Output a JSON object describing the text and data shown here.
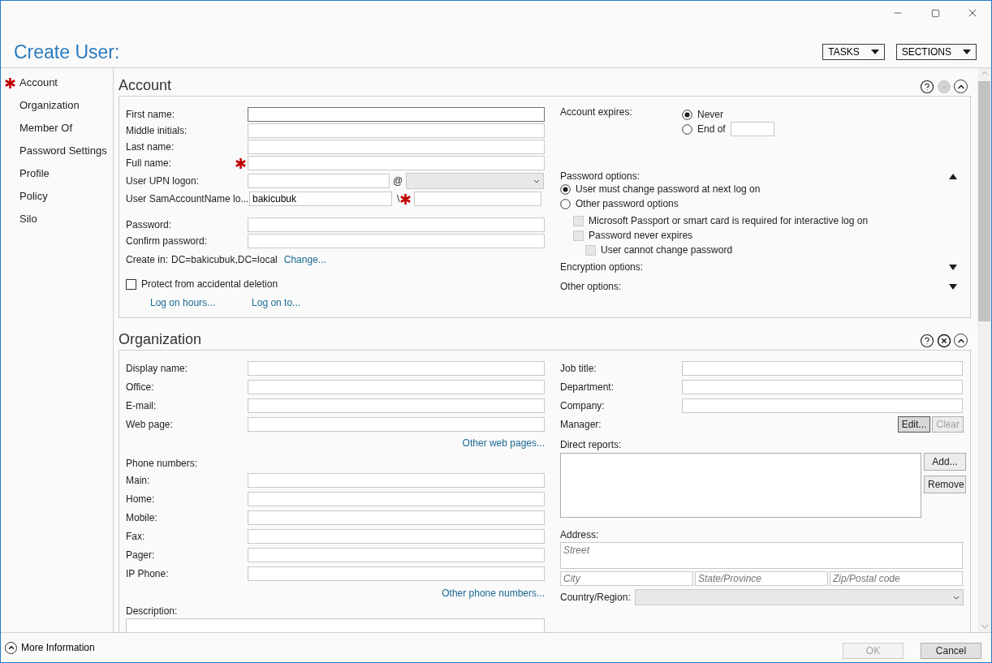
{
  "window": {
    "title": "Create User:"
  },
  "header_buttons": [
    {
      "label": "TASKS"
    },
    {
      "label": "SECTIONS"
    }
  ],
  "nav": [
    {
      "label": "Account",
      "required": true
    },
    {
      "label": "Organization",
      "required": false
    },
    {
      "label": "Member Of",
      "required": false
    },
    {
      "label": "Password Settings",
      "required": false
    },
    {
      "label": "Profile",
      "required": false
    },
    {
      "label": "Policy",
      "required": false
    },
    {
      "label": "Silo",
      "required": false
    }
  ],
  "account": {
    "title": "Account",
    "close_disabled": true,
    "identity_fields": [
      {
        "kind": "text",
        "label": "First name:",
        "required": false,
        "focused": true
      },
      {
        "kind": "text",
        "label": "Middle initials:",
        "required": false,
        "focused": false
      },
      {
        "kind": "text",
        "label": "Last name:",
        "required": false,
        "focused": false
      },
      {
        "kind": "text",
        "label": "Full name:",
        "required": true,
        "focused": false
      },
      {
        "kind": "upn",
        "label": "User UPN logon:",
        "separator": "@",
        "required": false,
        "focused": false
      },
      {
        "kind": "sam",
        "label": "User SamAccountName lo...",
        "value": "bakicubuk",
        "separator": "\\",
        "required": true,
        "focused": false
      }
    ],
    "password_fields": [
      {
        "label": "Password:"
      },
      {
        "label": "Confirm password:"
      }
    ],
    "create_in": {
      "label": "Create in:",
      "value": "DC=bakicubuk,DC=local",
      "link": "Change..."
    },
    "protect": {
      "label": "Protect from accidental deletion",
      "checked": false
    },
    "links": [
      "Log on hours...",
      "Log on to..."
    ],
    "expires": {
      "label": "Account expires:",
      "options": [
        {
          "label": "Never",
          "selected": true
        },
        {
          "label": "End of",
          "selected": false
        }
      ]
    },
    "password_options": {
      "label": "Password options:",
      "expanded": true,
      "options": [
        {
          "label": "User must change password at next log on",
          "selected": true
        },
        {
          "label": "Other password options",
          "selected": false
        }
      ],
      "checkboxes": [
        {
          "label": "Microsoft Passport or smart card is required for interactive log on",
          "checked": false,
          "disabled": true
        },
        {
          "label": "Password never expires",
          "checked": false,
          "disabled": true,
          "children": [
            {
              "label": "User cannot change password",
              "checked": false,
              "disabled": true
            }
          ]
        }
      ]
    },
    "collapsibles": [
      {
        "label": "Encryption options:",
        "expanded": false
      },
      {
        "label": "Other options:",
        "expanded": false
      }
    ]
  },
  "organization": {
    "title": "Organization",
    "close_disabled": false,
    "fields": [
      {
        "label": "Display name:"
      },
      {
        "label": "Office:"
      },
      {
        "label": "E-mail:"
      },
      {
        "label": "Web page:"
      }
    ],
    "web_link": "Other web pages...",
    "phone_heading": "Phone numbers:",
    "phones": [
      {
        "label": "Main:"
      },
      {
        "label": "Home:"
      },
      {
        "label": "Mobile:"
      },
      {
        "label": "Fax:"
      },
      {
        "label": "Pager:"
      },
      {
        "label": "IP Phone:"
      }
    ],
    "phone_link": "Other phone numbers...",
    "description_label": "Description:",
    "job_fields": [
      {
        "label": "Job title:"
      },
      {
        "label": "Department:"
      },
      {
        "label": "Company:"
      }
    ],
    "manager": {
      "label": "Manager:",
      "buttons": [
        {
          "label": "Edit...",
          "disabled": false
        },
        {
          "label": "Clear",
          "disabled": true
        }
      ]
    },
    "direct_reports": {
      "label": "Direct reports:",
      "buttons": [
        {
          "label": "Add...",
          "disabled": false
        },
        {
          "label": "Remove",
          "disabled": false
        }
      ]
    },
    "address": {
      "label": "Address:",
      "street_placeholder": "Street",
      "parts": [
        {
          "placeholder": "City"
        },
        {
          "placeholder": "State/Province"
        },
        {
          "placeholder": "Zip/Postal code"
        }
      ],
      "country_label": "Country/Region:"
    }
  },
  "footer": {
    "more_info": "More Information",
    "buttons": [
      {
        "label": "OK",
        "disabled": true
      },
      {
        "label": "Cancel",
        "disabled": false
      }
    ]
  }
}
